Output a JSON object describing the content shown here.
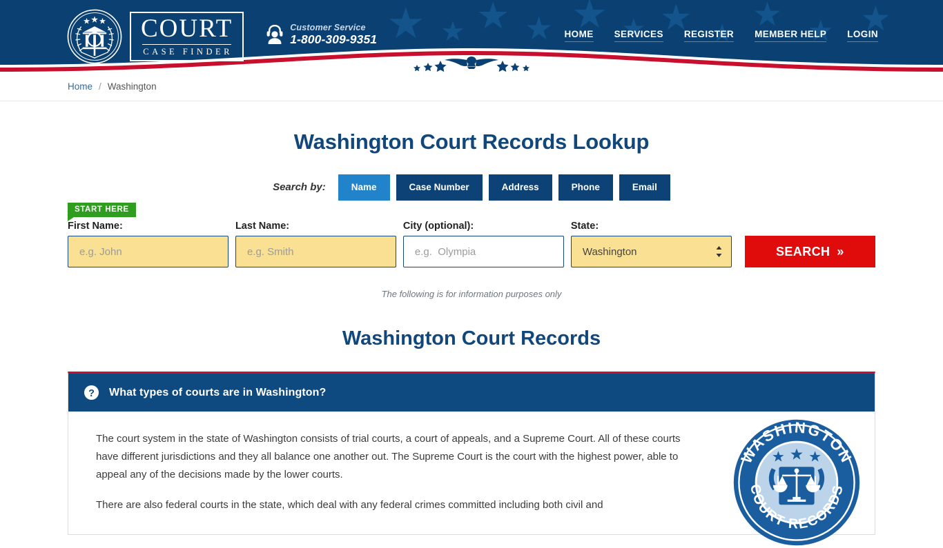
{
  "header": {
    "logo": {
      "emblem_icon": "court-emblem-icon",
      "title": "COURT",
      "subtitle": "CASE FINDER"
    },
    "customer_service": {
      "icon": "headset-support-icon",
      "label": "Customer Service",
      "phone": "1-800-309-9351"
    },
    "nav": [
      {
        "label": "HOME"
      },
      {
        "label": "SERVICES"
      },
      {
        "label": "REGISTER"
      },
      {
        "label": "MEMBER HELP"
      },
      {
        "label": "LOGIN"
      }
    ],
    "eagle_icon": "eagle-emblem-icon"
  },
  "breadcrumb": {
    "home": "Home",
    "separator": "/",
    "current": "Washington"
  },
  "main": {
    "page_title": "Washington Court Records Lookup",
    "search_by_label": "Search by:",
    "tabs": [
      {
        "label": "Name",
        "active": true
      },
      {
        "label": "Case Number",
        "active": false
      },
      {
        "label": "Address",
        "active": false
      },
      {
        "label": "Phone",
        "active": false
      },
      {
        "label": "Email",
        "active": false
      }
    ],
    "start_badge": "START HERE",
    "form": {
      "first_name": {
        "label": "First Name:",
        "placeholder": "e.g. John",
        "value": ""
      },
      "last_name": {
        "label": "Last Name:",
        "placeholder": "e.g. Smith",
        "value": ""
      },
      "city": {
        "label": "City (optional):",
        "placeholder": "e.g.  Olympia",
        "value": ""
      },
      "state": {
        "label": "State:",
        "selected": "Washington"
      },
      "search_button": "SEARCH",
      "search_button_chevron": "»"
    },
    "disclaimer": "The following is for information purposes only",
    "section_title": "Washington Court Records"
  },
  "faq": {
    "icon": "question-mark-circle-icon",
    "question": "What types of courts are in Washington?",
    "paragraphs": [
      "The court system in the state of Washington consists of trial courts, a court of appeals, and a Supreme Court. All of these courts have different jurisdictions and they all balance one another out. The Supreme Court is the court with the highest power, able to appeal any of the decisions made by the lower courts.",
      "There are also federal courts in the state, which deal with any federal crimes committed including both civil and"
    ],
    "seal": {
      "icon": "washington-state-seal-icon",
      "text_top": "WASHINGTON",
      "text_bottom": "COURT RECORDS"
    }
  },
  "colors": {
    "navy": "#0b4172",
    "accent_blue": "#2183c9",
    "red": "#e00b0b",
    "green": "#2f9e1f",
    "field_yellow": "#f9e093"
  }
}
